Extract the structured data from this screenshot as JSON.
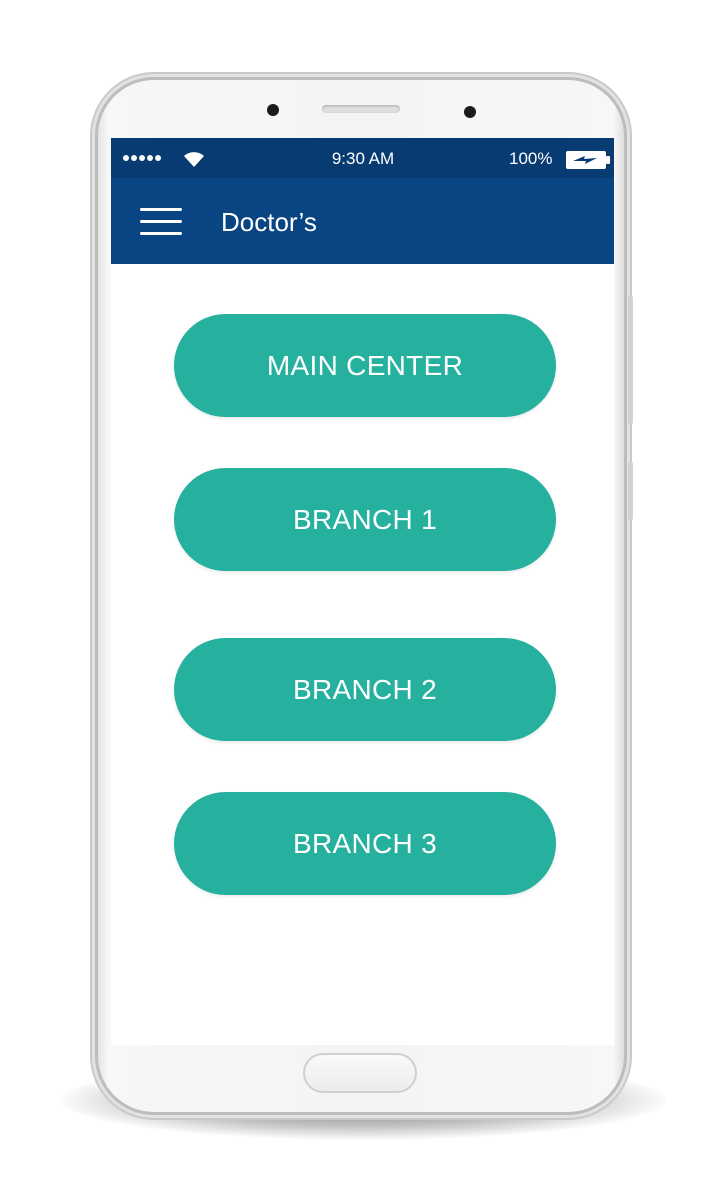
{
  "status_bar": {
    "time": "9:30 AM",
    "battery_percent": "100%",
    "signal_icon": "signal-dots-icon",
    "wifi_icon": "wifi-icon",
    "battery_icon": "battery-charging-icon"
  },
  "app_bar": {
    "menu_icon": "hamburger-menu-icon",
    "title": "Doctor’s"
  },
  "buttons": [
    {
      "label": "MAIN CENTER"
    },
    {
      "label": "BRANCH 1"
    },
    {
      "label": "BRANCH 2"
    },
    {
      "label": "BRANCH 3"
    }
  ],
  "colors": {
    "status_bar": "#073b72",
    "app_bar": "#084582",
    "button": "#26b19e",
    "button_text": "#ffffff"
  }
}
